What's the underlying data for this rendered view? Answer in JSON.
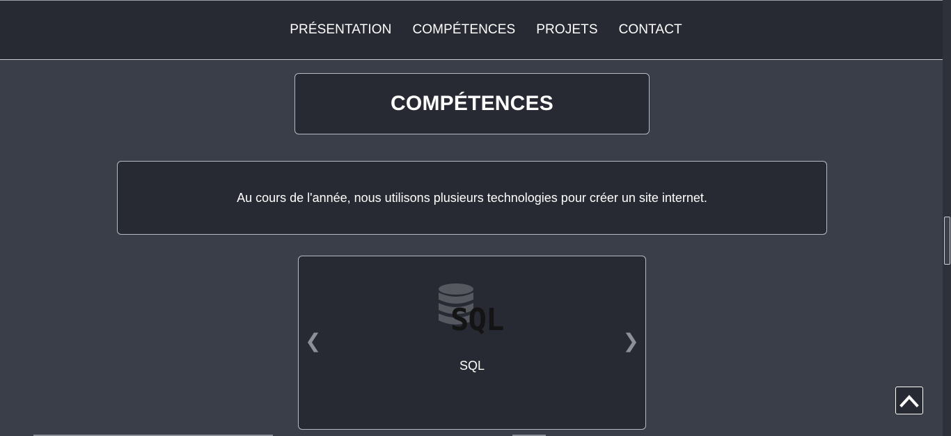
{
  "nav": {
    "items": [
      {
        "label": "PRÉSENTATION"
      },
      {
        "label": "COMPÉTENCES"
      },
      {
        "label": "PROJETS"
      },
      {
        "label": "CONTACT"
      }
    ]
  },
  "section": {
    "title": "COMPÉTENCES",
    "intro": "Au cours de l'année, nous utilisons plusieurs technologies pour créer un site internet."
  },
  "carousel": {
    "prev_icon": "chevron-left-icon",
    "next_icon": "chevron-right-icon",
    "prev_glyph": "❮",
    "next_glyph": "❯",
    "slide": {
      "logo_text": "SQL",
      "logo_icon": "database-icon",
      "caption": "SQL"
    }
  },
  "back_to_top": {
    "icon": "chevron-up-icon"
  },
  "colors": {
    "background": "#3a3e48",
    "panel": "#272a33",
    "border": "#b7bac1",
    "text": "#ffffff"
  }
}
